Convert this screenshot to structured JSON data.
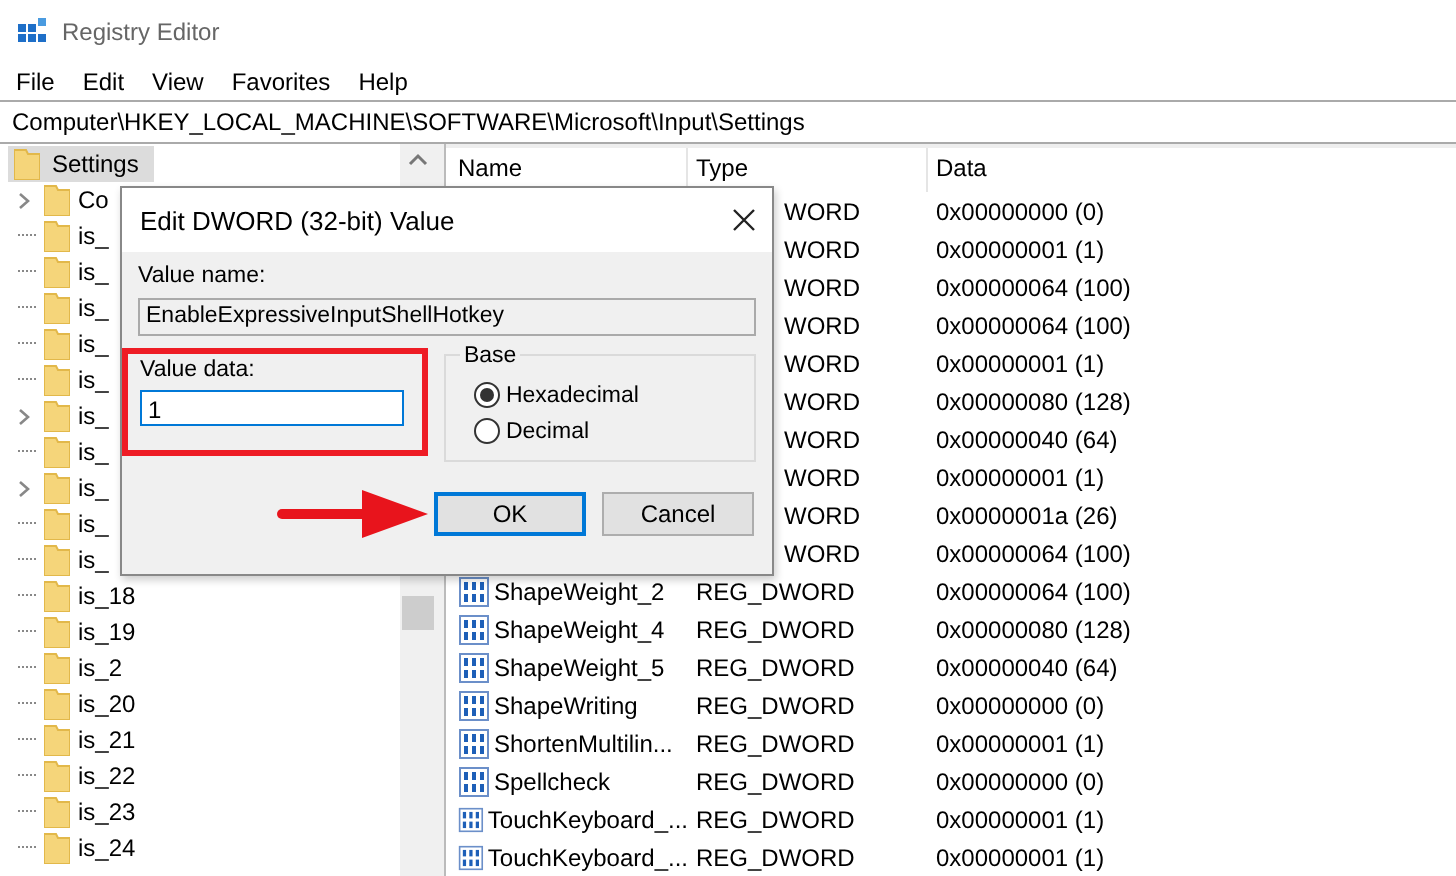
{
  "window": {
    "title": "Registry Editor"
  },
  "menu": [
    "File",
    "Edit",
    "View",
    "Favorites",
    "Help"
  ],
  "address": "Computer\\HKEY_LOCAL_MACHINE\\SOFTWARE\\Microsoft\\Input\\Settings",
  "tree": {
    "label": "Settings",
    "selected": true,
    "children": [
      {
        "label": "Co",
        "has_children": true
      },
      {
        "label": "is_",
        "has_children": false
      },
      {
        "label": "is_",
        "has_children": false
      },
      {
        "label": "is_",
        "has_children": false
      },
      {
        "label": "is_",
        "has_children": false
      },
      {
        "label": "is_",
        "has_children": false
      },
      {
        "label": "is_",
        "has_children": true
      },
      {
        "label": "is_",
        "has_children": false
      },
      {
        "label": "is_",
        "has_children": true
      },
      {
        "label": "is_",
        "has_children": false
      },
      {
        "label": "is_",
        "has_children": false
      },
      {
        "label": "is_18",
        "has_children": false
      },
      {
        "label": "is_19",
        "has_children": false
      },
      {
        "label": "is_2",
        "has_children": false
      },
      {
        "label": "is_20",
        "has_children": false
      },
      {
        "label": "is_21",
        "has_children": false
      },
      {
        "label": "is_22",
        "has_children": false
      },
      {
        "label": "is_23",
        "has_children": false
      },
      {
        "label": "is_24",
        "has_children": false
      }
    ]
  },
  "columns": [
    "Name",
    "Type",
    "Data"
  ],
  "values": [
    {
      "type": "WORD",
      "data": "0x00000000 (0)"
    },
    {
      "type": "WORD",
      "data": "0x00000001 (1)"
    },
    {
      "type": "WORD",
      "data": "0x00000064 (100)"
    },
    {
      "type": "WORD",
      "data": "0x00000064 (100)"
    },
    {
      "type": "WORD",
      "data": "0x00000001 (1)"
    },
    {
      "type": "WORD",
      "data": "0x00000080 (128)"
    },
    {
      "type": "WORD",
      "data": "0x00000040 (64)"
    },
    {
      "type": "WORD",
      "data": "0x00000001 (1)"
    },
    {
      "type": "WORD",
      "data": "0x0000001a (26)"
    },
    {
      "type": "WORD",
      "data": "0x00000064 (100)"
    },
    {
      "name": "ShapeWeight_2",
      "type": "REG_DWORD",
      "data": "0x00000064 (100)"
    },
    {
      "name": "ShapeWeight_4",
      "type": "REG_DWORD",
      "data": "0x00000080 (128)"
    },
    {
      "name": "ShapeWeight_5",
      "type": "REG_DWORD",
      "data": "0x00000040 (64)"
    },
    {
      "name": "ShapeWriting",
      "type": "REG_DWORD",
      "data": "0x00000000 (0)"
    },
    {
      "name": "ShortenMultilin...",
      "type": "REG_DWORD",
      "data": "0x00000001 (1)"
    },
    {
      "name": "Spellcheck",
      "type": "REG_DWORD",
      "data": "0x00000000 (0)"
    },
    {
      "name": "TouchKeyboard_...",
      "type": "REG_DWORD",
      "data": "0x00000001 (1)"
    },
    {
      "name": "TouchKeyboard_...",
      "type": "REG_DWORD",
      "data": "0x00000001 (1)"
    }
  ],
  "dialog": {
    "title": "Edit DWORD (32-bit) Value",
    "value_name_label": "Value name:",
    "value_name": "EnableExpressiveInputShellHotkey",
    "value_data_label": "Value data:",
    "value_data": "1",
    "base_label": "Base",
    "bases": [
      {
        "label": "Hexadecimal",
        "selected": true
      },
      {
        "label": "Decimal",
        "selected": false
      }
    ],
    "buttons": [
      {
        "label": "OK",
        "default": true
      },
      {
        "label": "Cancel",
        "default": false
      }
    ]
  }
}
